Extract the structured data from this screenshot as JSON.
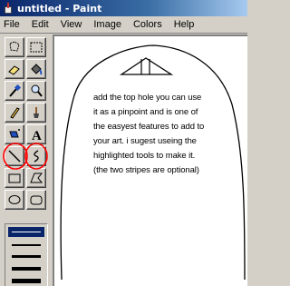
{
  "window": {
    "title": "untitled - Paint"
  },
  "menu": [
    "File",
    "Edit",
    "View",
    "Image",
    "Colors",
    "Help"
  ],
  "tools": [
    "free-select",
    "select",
    "eraser",
    "fill-with-color",
    "pick-color",
    "magnifier",
    "pencil",
    "brush",
    "airbrush",
    "text",
    "line",
    "curve",
    "rectangle",
    "polygon",
    "ellipse",
    "rounded-rectangle"
  ],
  "highlighted_tools": [
    "line",
    "curve"
  ],
  "highlight_color": "#ff0000",
  "canvas": {
    "note_lines": [
      "add the top hole you can use",
      "it as a pinpoint and is one of",
      "the easyest features to add to",
      "your art. i sugest useing the",
      "highlighted tools to make it.",
      "(the two stripes are optional)"
    ]
  }
}
